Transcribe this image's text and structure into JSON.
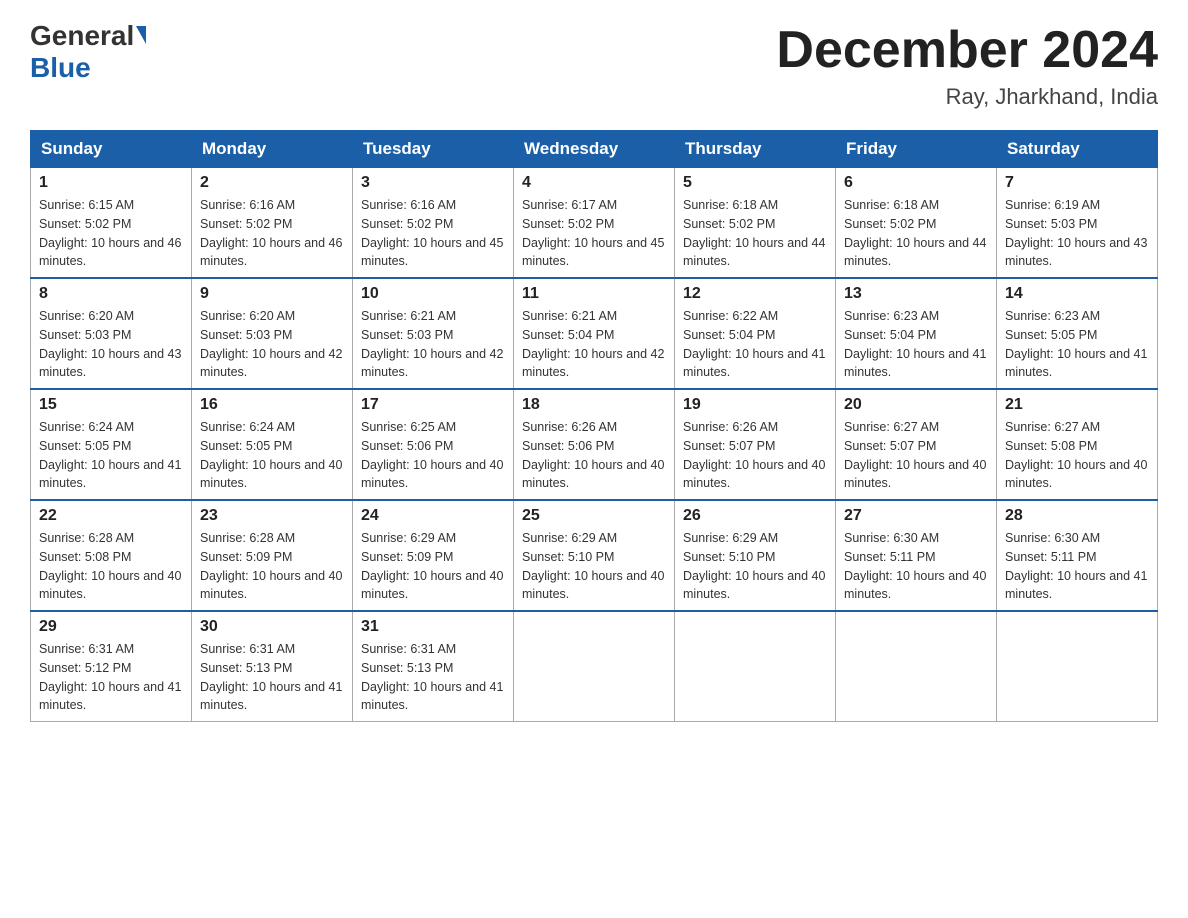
{
  "header": {
    "logo_general": "General",
    "logo_blue": "Blue",
    "month_title": "December 2024",
    "location": "Ray, Jharkhand, India"
  },
  "days_of_week": [
    "Sunday",
    "Monday",
    "Tuesday",
    "Wednesday",
    "Thursday",
    "Friday",
    "Saturday"
  ],
  "weeks": [
    [
      {
        "day": "1",
        "sunrise": "6:15 AM",
        "sunset": "5:02 PM",
        "daylight": "10 hours and 46 minutes."
      },
      {
        "day": "2",
        "sunrise": "6:16 AM",
        "sunset": "5:02 PM",
        "daylight": "10 hours and 46 minutes."
      },
      {
        "day": "3",
        "sunrise": "6:16 AM",
        "sunset": "5:02 PM",
        "daylight": "10 hours and 45 minutes."
      },
      {
        "day": "4",
        "sunrise": "6:17 AM",
        "sunset": "5:02 PM",
        "daylight": "10 hours and 45 minutes."
      },
      {
        "day": "5",
        "sunrise": "6:18 AM",
        "sunset": "5:02 PM",
        "daylight": "10 hours and 44 minutes."
      },
      {
        "day": "6",
        "sunrise": "6:18 AM",
        "sunset": "5:02 PM",
        "daylight": "10 hours and 44 minutes."
      },
      {
        "day": "7",
        "sunrise": "6:19 AM",
        "sunset": "5:03 PM",
        "daylight": "10 hours and 43 minutes."
      }
    ],
    [
      {
        "day": "8",
        "sunrise": "6:20 AM",
        "sunset": "5:03 PM",
        "daylight": "10 hours and 43 minutes."
      },
      {
        "day": "9",
        "sunrise": "6:20 AM",
        "sunset": "5:03 PM",
        "daylight": "10 hours and 42 minutes."
      },
      {
        "day": "10",
        "sunrise": "6:21 AM",
        "sunset": "5:03 PM",
        "daylight": "10 hours and 42 minutes."
      },
      {
        "day": "11",
        "sunrise": "6:21 AM",
        "sunset": "5:04 PM",
        "daylight": "10 hours and 42 minutes."
      },
      {
        "day": "12",
        "sunrise": "6:22 AM",
        "sunset": "5:04 PM",
        "daylight": "10 hours and 41 minutes."
      },
      {
        "day": "13",
        "sunrise": "6:23 AM",
        "sunset": "5:04 PM",
        "daylight": "10 hours and 41 minutes."
      },
      {
        "day": "14",
        "sunrise": "6:23 AM",
        "sunset": "5:05 PM",
        "daylight": "10 hours and 41 minutes."
      }
    ],
    [
      {
        "day": "15",
        "sunrise": "6:24 AM",
        "sunset": "5:05 PM",
        "daylight": "10 hours and 41 minutes."
      },
      {
        "day": "16",
        "sunrise": "6:24 AM",
        "sunset": "5:05 PM",
        "daylight": "10 hours and 40 minutes."
      },
      {
        "day": "17",
        "sunrise": "6:25 AM",
        "sunset": "5:06 PM",
        "daylight": "10 hours and 40 minutes."
      },
      {
        "day": "18",
        "sunrise": "6:26 AM",
        "sunset": "5:06 PM",
        "daylight": "10 hours and 40 minutes."
      },
      {
        "day": "19",
        "sunrise": "6:26 AM",
        "sunset": "5:07 PM",
        "daylight": "10 hours and 40 minutes."
      },
      {
        "day": "20",
        "sunrise": "6:27 AM",
        "sunset": "5:07 PM",
        "daylight": "10 hours and 40 minutes."
      },
      {
        "day": "21",
        "sunrise": "6:27 AM",
        "sunset": "5:08 PM",
        "daylight": "10 hours and 40 minutes."
      }
    ],
    [
      {
        "day": "22",
        "sunrise": "6:28 AM",
        "sunset": "5:08 PM",
        "daylight": "10 hours and 40 minutes."
      },
      {
        "day": "23",
        "sunrise": "6:28 AM",
        "sunset": "5:09 PM",
        "daylight": "10 hours and 40 minutes."
      },
      {
        "day": "24",
        "sunrise": "6:29 AM",
        "sunset": "5:09 PM",
        "daylight": "10 hours and 40 minutes."
      },
      {
        "day": "25",
        "sunrise": "6:29 AM",
        "sunset": "5:10 PM",
        "daylight": "10 hours and 40 minutes."
      },
      {
        "day": "26",
        "sunrise": "6:29 AM",
        "sunset": "5:10 PM",
        "daylight": "10 hours and 40 minutes."
      },
      {
        "day": "27",
        "sunrise": "6:30 AM",
        "sunset": "5:11 PM",
        "daylight": "10 hours and 40 minutes."
      },
      {
        "day": "28",
        "sunrise": "6:30 AM",
        "sunset": "5:11 PM",
        "daylight": "10 hours and 41 minutes."
      }
    ],
    [
      {
        "day": "29",
        "sunrise": "6:31 AM",
        "sunset": "5:12 PM",
        "daylight": "10 hours and 41 minutes."
      },
      {
        "day": "30",
        "sunrise": "6:31 AM",
        "sunset": "5:13 PM",
        "daylight": "10 hours and 41 minutes."
      },
      {
        "day": "31",
        "sunrise": "6:31 AM",
        "sunset": "5:13 PM",
        "daylight": "10 hours and 41 minutes."
      },
      null,
      null,
      null,
      null
    ]
  ]
}
